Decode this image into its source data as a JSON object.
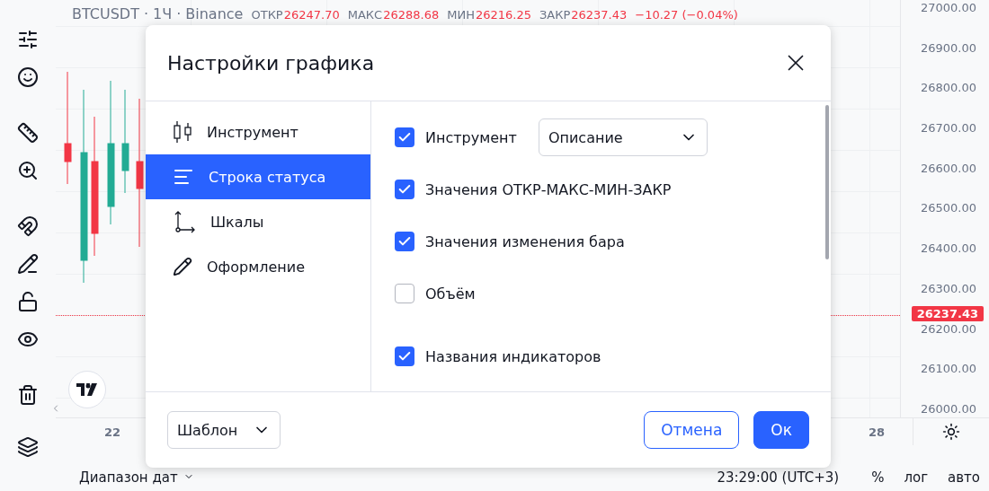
{
  "legend": {
    "parts": [
      "BTCUSDT",
      "1Ч",
      "Binance"
    ],
    "separator": "·",
    "values": [
      {
        "label": "ОТКР",
        "value": "26247.70"
      },
      {
        "label": "МАКС",
        "value": "26288.68"
      },
      {
        "label": "МИН",
        "value": "26216.25"
      },
      {
        "label": "ЗАКР",
        "value": "26237.43"
      }
    ],
    "change": "−10.27 (−0.04%)"
  },
  "price_axis": {
    "ticks": [
      "27000.00",
      "26900.00",
      "26800.00",
      "26700.00",
      "26600.00",
      "26500.00",
      "26400.00",
      "26300.00",
      "26200.00",
      "26100.00",
      "26000.00"
    ],
    "last_price": "26237.43"
  },
  "time_axis": {
    "ticks": [
      "22",
      "28"
    ]
  },
  "bottom_bar": {
    "date_range": "Диапазон дат",
    "time": "23:29:00 (UTC+3)",
    "buttons": [
      "%",
      "лог",
      "авто"
    ]
  },
  "dialog": {
    "title": "Настройки графика",
    "tabs": [
      {
        "kind": "instrument",
        "label": "Инструмент",
        "selected": false
      },
      {
        "kind": "status",
        "label": "Строка статуса",
        "selected": true
      },
      {
        "kind": "scales",
        "label": "Шкалы",
        "selected": false
      },
      {
        "kind": "appearance",
        "label": "Оформление",
        "selected": false
      }
    ],
    "options": [
      {
        "kind": "select",
        "label": "Инструмент",
        "checked": true,
        "value": "Описание"
      },
      {
        "kind": "checkbox",
        "label": "Значения ОТКР-МАКС-МИН-ЗАКР",
        "checked": true
      },
      {
        "kind": "checkbox",
        "label": "Значения изменения бара",
        "checked": true
      },
      {
        "kind": "checkbox",
        "label": "Объём",
        "checked": false
      },
      {
        "kind": "section",
        "label": "Названия индикаторов",
        "checked": true
      }
    ],
    "template": "Шаблон",
    "cancel": "Отмена",
    "ok": "Ок"
  }
}
